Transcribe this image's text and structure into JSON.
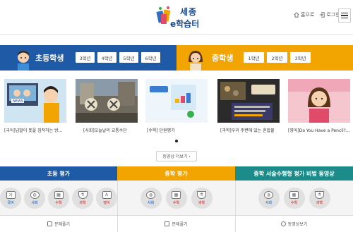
{
  "header": {
    "logo_line1": "세종",
    "logo_line2": "e학습터",
    "home_label": "홈으로",
    "login_label": "로그인"
  },
  "elementary": {
    "title": "초등학생",
    "grades": [
      "3학년",
      "4학년",
      "5학년",
      "6학년"
    ],
    "color": "#1e5aa5"
  },
  "middle": {
    "title": "중학생",
    "grades": [
      "1학년",
      "2학년",
      "3학년"
    ],
    "color": "#f2a400"
  },
  "videos": [
    {
      "caption": "[국어]넘말이 뜻을 짐작하는 방…",
      "icon": "news-illustration"
    },
    {
      "caption": "[사회]오늘날의 교통수단",
      "icon": "transport-photo"
    },
    {
      "caption": "[수학] 단원평가",
      "icon": "math-blocks"
    },
    {
      "caption": "[과학]우리 주변에 있는 혼합물",
      "icon": "mixture-slide"
    },
    {
      "caption": "[영어]Do You Have a Pencil?…",
      "icon": "english-teacher"
    }
  ],
  "more_label": "동영상 더보기 ›",
  "panels": [
    {
      "title": "초등 평가",
      "color": "#1e5aa5",
      "subjects": [
        {
          "label": "국어",
          "glyph": "가",
          "color": "#3b7bd0"
        },
        {
          "label": "사회",
          "glyph": "◍",
          "color": "#3b7bd0"
        },
        {
          "label": "수학",
          "glyph": "▦",
          "color": "#e0504c"
        },
        {
          "label": "과학",
          "glyph": "⚗",
          "color": "#e0504c"
        },
        {
          "label": "영어",
          "glyph": "A",
          "color": "#e0504c"
        }
      ],
      "footer": "문제풀기"
    },
    {
      "title": "중학 평가",
      "color": "#f2a400",
      "subjects": [
        {
          "label": "사회",
          "glyph": "◍",
          "color": "#3b7bd0"
        },
        {
          "label": "수학",
          "glyph": "▦",
          "color": "#e0504c"
        },
        {
          "label": "과학",
          "glyph": "⚗",
          "color": "#e0504c"
        }
      ],
      "footer": "문제풀기"
    },
    {
      "title": "중학 서술수행형 평가 비법 동영상",
      "color": "#1c8c8a",
      "subjects": [
        {
          "label": "사회",
          "glyph": "◍",
          "color": "#3b7bd0"
        },
        {
          "label": "수학",
          "glyph": "▦",
          "color": "#e0504c"
        },
        {
          "label": "과학",
          "glyph": "⚗",
          "color": "#e0504c"
        }
      ],
      "footer": "동영상보기"
    }
  ]
}
